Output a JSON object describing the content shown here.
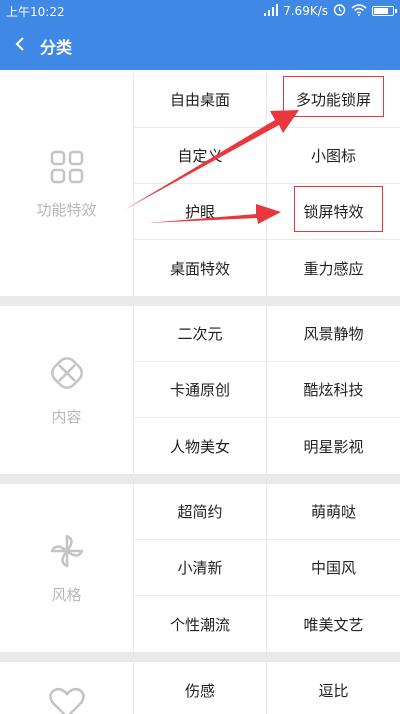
{
  "status_bar": {
    "time": "上午10:22",
    "network_speed": "7.69K/s",
    "icons": [
      "alarm-icon",
      "wifi-icon",
      "battery-icon"
    ],
    "battery_level": 0.8
  },
  "header": {
    "title": "分类",
    "back_icon": "chevron-left-icon",
    "background": "#3f88e6"
  },
  "sections": [
    {
      "label": "功能特效",
      "icon": "grid-icon",
      "items": [
        "自由桌面",
        "多功能锁屏",
        "自定义",
        "小图标",
        "护眼",
        "锁屏特效",
        "桌面特效",
        "重力感应"
      ]
    },
    {
      "label": "内容",
      "icon": "ribbon-icon",
      "items": [
        "二次元",
        "风景静物",
        "卡通原创",
        "酷炫科技",
        "人物美女",
        "明星影视"
      ]
    },
    {
      "label": "风格",
      "icon": "pinwheel-icon",
      "items": [
        "超简约",
        "萌萌哒",
        "小清新",
        "中国风",
        "个性潮流",
        "唯美文艺"
      ]
    },
    {
      "label": "",
      "icon": "heart-icon",
      "items": [
        "伤感",
        "逗比"
      ]
    }
  ],
  "annotations": {
    "color": "#e8383d"
  }
}
